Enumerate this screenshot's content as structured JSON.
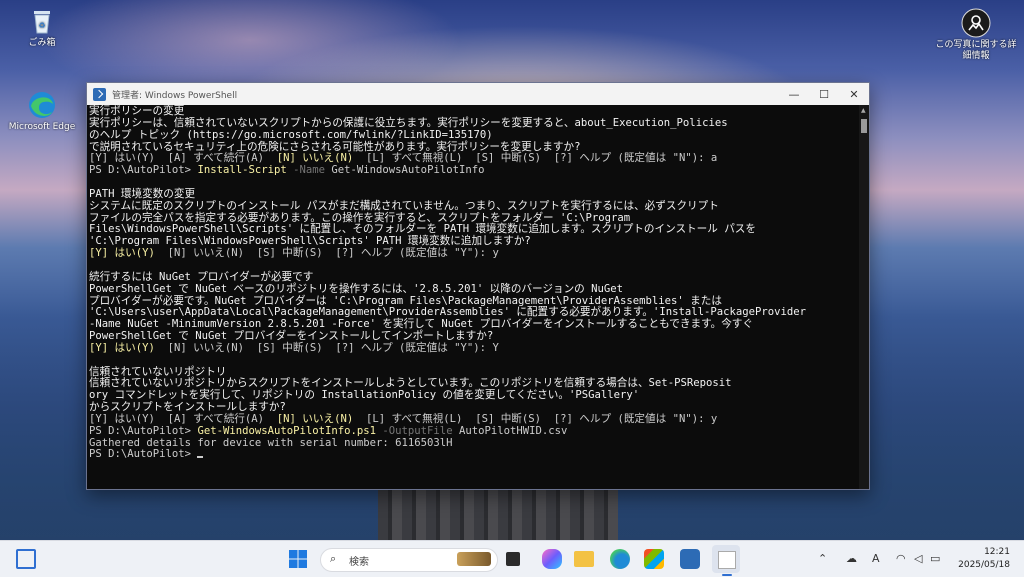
{
  "desktop": {
    "icons": [
      {
        "label": "ごみ箱"
      },
      {
        "label": "Microsoft Edge"
      }
    ],
    "spotlight_label_line1": "この写真に関する詳",
    "spotlight_label_line2": "細情報"
  },
  "window": {
    "title": "管理者: Windows PowerShell",
    "minimize": "—",
    "maximize": "☐",
    "close": "✕"
  },
  "console_lines": [
    [
      {
        "t": "実行ポリシーの変更",
        "c": "w"
      }
    ],
    [
      {
        "t": "実行ポリシーは、信頼されていないスクリプトからの保護に役立ちます。実行ポリシーを変更すると、about_Execution_Policies",
        "c": "w"
      }
    ],
    [
      {
        "t": "のヘルプ トピック (https://go.microsoft.com/fwlink/?LinkID=135170)",
        "c": "w"
      }
    ],
    [
      {
        "t": "で説明されているセキュリティ上の危険にさらされる可能性があります。実行ポリシーを変更しますか?",
        "c": "w"
      }
    ],
    [
      {
        "t": "[Y] はい(Y)  [A] すべて続行(A)  ",
        "c": ""
      },
      {
        "t": "[N] いいえ(N)",
        "c": "y"
      },
      {
        "t": "  [L] すべて無視(L)  [S] 中断(S)  [?] ヘルプ (既定値は \"N\"): a",
        "c": ""
      }
    ],
    [
      {
        "t": "PS D:\\AutoPilot> ",
        "c": ""
      },
      {
        "t": "Install-Script",
        "c": "y"
      },
      {
        "t": " -Name",
        "c": "g"
      },
      {
        "t": " Get-WindowsAutoPilotInfo",
        "c": ""
      }
    ],
    [
      {
        "t": "",
        "c": ""
      }
    ],
    [
      {
        "t": "PATH 環境変数の変更",
        "c": "w"
      }
    ],
    [
      {
        "t": "システムに既定のスクリプトのインストール パスがまだ構成されていません。つまり、スクリプトを実行するには、必ずスクリプト",
        "c": "w"
      }
    ],
    [
      {
        "t": "ファイルの完全パスを指定する必要があります。この操作を実行すると、スクリプトをフォルダー 'C:\\Program",
        "c": "w"
      }
    ],
    [
      {
        "t": "Files\\WindowsPowerShell\\Scripts' に配置し、そのフォルダーを PATH 環境変数に追加します。スクリプトのインストール パスを",
        "c": "w"
      }
    ],
    [
      {
        "t": "'C:\\Program Files\\WindowsPowerShell\\Scripts' PATH 環境変数に追加しますか?",
        "c": "w"
      }
    ],
    [
      {
        "t": "[Y] はい(Y)",
        "c": "y"
      },
      {
        "t": "  [N] いいえ(N)  [S] 中断(S)  [?] ヘルプ (既定値は \"Y\"): y",
        "c": ""
      }
    ],
    [
      {
        "t": "",
        "c": ""
      }
    ],
    [
      {
        "t": "続行するには NuGet プロバイダーが必要です",
        "c": "w"
      }
    ],
    [
      {
        "t": "PowerShellGet で NuGet ベースのリポジトリを操作するには、'2.8.5.201' 以降のバージョンの NuGet",
        "c": "w"
      }
    ],
    [
      {
        "t": "プロバイダーが必要です。NuGet プロバイダーは 'C:\\Program Files\\PackageManagement\\ProviderAssemblies' または",
        "c": "w"
      }
    ],
    [
      {
        "t": "'C:\\Users\\user\\AppData\\Local\\PackageManagement\\ProviderAssemblies' に配置する必要があります。'Install-PackageProvider",
        "c": "w"
      }
    ],
    [
      {
        "t": "-Name NuGet -MinimumVersion 2.8.5.201 -Force' を実行して NuGet プロバイダーをインストールすることもできます。今すぐ",
        "c": "w"
      }
    ],
    [
      {
        "t": "PowerShellGet で NuGet プロバイダーをインストールしてインポートしますか?",
        "c": "w"
      }
    ],
    [
      {
        "t": "[Y] はい(Y)",
        "c": "y"
      },
      {
        "t": "  [N] いいえ(N)  [S] 中断(S)  [?] ヘルプ (既定値は \"Y\"): Y",
        "c": ""
      }
    ],
    [
      {
        "t": "",
        "c": ""
      }
    ],
    [
      {
        "t": "信頼されていないリポジトリ",
        "c": "w"
      }
    ],
    [
      {
        "t": "信頼されていないリポジトリからスクリプトをインストールしようとしています。このリポジトリを信頼する場合は、Set-PSReposit",
        "c": "w"
      }
    ],
    [
      {
        "t": "ory コマンドレットを実行して、リポジトリの InstallationPolicy の値を変更してください。'PSGallery'",
        "c": "w"
      }
    ],
    [
      {
        "t": "からスクリプトをインストールしますか?",
        "c": "w"
      }
    ],
    [
      {
        "t": "[Y] はい(Y)  [A] すべて続行(A)  ",
        "c": ""
      },
      {
        "t": "[N] いいえ(N)",
        "c": "y"
      },
      {
        "t": "  [L] すべて無視(L)  [S] 中断(S)  [?] ヘルプ (既定値は \"N\"): y",
        "c": ""
      }
    ],
    [
      {
        "t": "PS D:\\AutoPilot> ",
        "c": ""
      },
      {
        "t": "Get-WindowsAutoPilotInfo.ps1",
        "c": "y"
      },
      {
        "t": " -OutputFile",
        "c": "g"
      },
      {
        "t": " AutoPilotHWID.csv",
        "c": ""
      }
    ],
    [
      {
        "t": "Gathered details for device with serial number: 6116503lH",
        "c": ""
      }
    ],
    [
      {
        "t": "PS D:\\AutoPilot> ",
        "c": ""
      }
    ]
  ],
  "taskbar": {
    "search_placeholder": "検索",
    "time": "12:21",
    "date": "2025/05/18",
    "ime": "A"
  },
  "colors": {
    "console_bg": "#0c0c0c",
    "console_text": "#cccccc",
    "console_yellow": "#f9f1a5",
    "console_gray": "#767676",
    "taskbar_bg": "#eef1f6"
  }
}
